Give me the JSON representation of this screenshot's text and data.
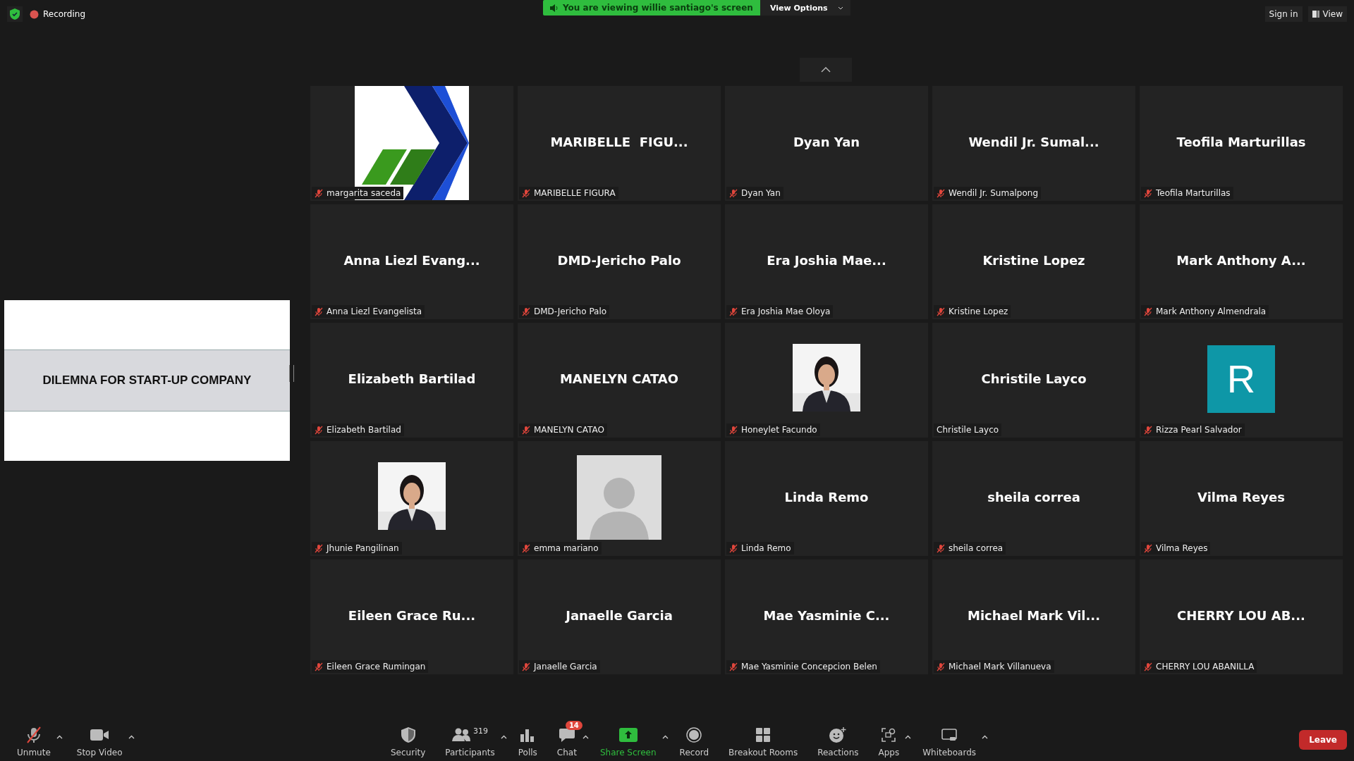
{
  "top_bar": {
    "recording_label": "Recording",
    "viewing_banner": "You are viewing willie santiago's screen",
    "view_options": "View Options",
    "sign_in": "Sign in",
    "view": "View"
  },
  "shared_screen": {
    "title": "DILEMNA FOR START-UP COMPANY"
  },
  "tiles": [
    {
      "kind": "logo",
      "name": "margarita saceda",
      "muted": true
    },
    {
      "kind": "name",
      "display_name": "MARIBELLE  FIGU...",
      "name": "MARIBELLE FIGURA",
      "muted": true
    },
    {
      "kind": "name",
      "display_name": "Dyan Yan",
      "name": "Dyan Yan",
      "muted": true
    },
    {
      "kind": "name",
      "display_name": "Wendil Jr. Sumal...",
      "name": "Wendil Jr. Sumalpong",
      "muted": true
    },
    {
      "kind": "name",
      "display_name": "Teofila Marturillas",
      "name": "Teofila Marturillas",
      "muted": true
    },
    {
      "kind": "name",
      "display_name": "Anna Liezl Evang...",
      "name": "Anna Liezl Evangelista",
      "muted": true
    },
    {
      "kind": "name",
      "display_name": "DMD-Jericho Palo",
      "name": "DMD-Jericho Palo",
      "muted": true
    },
    {
      "kind": "name",
      "display_name": "Era Joshia Mae...",
      "name": "Era Joshia Mae Oloya",
      "muted": true
    },
    {
      "kind": "name",
      "display_name": "Kristine Lopez",
      "name": "Kristine Lopez",
      "muted": true
    },
    {
      "kind": "name",
      "display_name": "Mark Anthony A...",
      "name": "Mark Anthony Almendrala",
      "muted": true
    },
    {
      "kind": "name",
      "display_name": "Elizabeth Bartilad",
      "name": "Elizabeth Bartilad",
      "muted": true
    },
    {
      "kind": "name",
      "display_name": "MANELYN CATAO",
      "name": "MANELYN CATAO",
      "muted": true
    },
    {
      "name": "Honeylet Facundo",
      "muted": true
    },
    {
      "kind": "name",
      "display_name": "Christile Layco",
      "name": "Christile Layco",
      "muted": false
    },
    {
      "kind": "letter",
      "letter": "R",
      "color": "#0e97a7",
      "name": "Rizza Pearl Salvador",
      "muted": true
    },
    {
      "name": "Jhunie Pangilinan",
      "muted": true
    },
    {
      "kind": "avatar",
      "name": "emma mariano",
      "muted": true
    },
    {
      "kind": "name",
      "display_name": "Linda Remo",
      "name": "Linda Remo",
      "muted": true
    },
    {
      "kind": "name",
      "display_name": "sheila correa",
      "name": "sheila correa",
      "muted": true
    },
    {
      "kind": "name",
      "display_name": "Vilma Reyes",
      "name": "Vilma Reyes",
      "muted": true
    },
    {
      "kind": "name",
      "display_name": "Eileen Grace Ru...",
      "name": "Eileen Grace Rumingan",
      "muted": true
    },
    {
      "kind": "name",
      "display_name": "Janaelle Garcia",
      "name": "Janaelle Garcia",
      "muted": true
    },
    {
      "kind": "name",
      "display_name": "Mae Yasminie C...",
      "name": "Mae Yasminie Concepcion Belen",
      "muted": true
    },
    {
      "kind": "name",
      "display_name": "Michael Mark Vil...",
      "name": "Michael Mark Villanueva",
      "muted": true
    },
    {
      "kind": "name",
      "display_name": "CHERRY LOU AB...",
      "name": "CHERRY LOU ABANILLA",
      "muted": true
    }
  ],
  "toolbar": {
    "left": [
      {
        "kind": "mic",
        "label": "Unmute",
        "caret": true
      },
      {
        "kind": "video",
        "label": "Stop Video",
        "caret": true
      }
    ],
    "center": [
      {
        "kind": "security",
        "label": "Security",
        "caret": false
      },
      {
        "kind": "participants",
        "label": "Participants",
        "count": "319",
        "caret": true
      },
      {
        "kind": "polls",
        "label": "Polls",
        "caret": false
      },
      {
        "kind": "chat",
        "label": "Chat",
        "badge": "14",
        "caret": true
      },
      {
        "kind": "share",
        "label": "Share Screen",
        "caret": true
      },
      {
        "kind": "record",
        "label": "Record",
        "caret": false
      },
      {
        "kind": "breakout",
        "label": "Breakout Rooms",
        "caret": false
      },
      {
        "kind": "reactions",
        "label": "Reactions",
        "caret": false
      },
      {
        "kind": "apps",
        "label": "Apps",
        "caret": true
      },
      {
        "kind": "whiteboard",
        "label": "Whiteboards",
        "caret": true
      }
    ],
    "leave": "Leave"
  }
}
